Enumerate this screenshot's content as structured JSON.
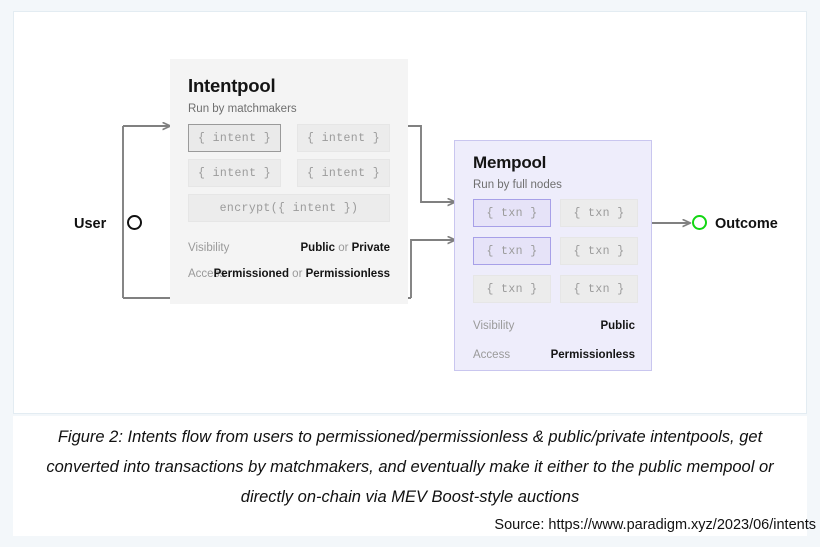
{
  "figure": {
    "caption": "Figure 2: Intents flow from users to permissioned/permissionless & public/private intentpools, get converted into transactions by matchmakers, and eventually make it either to the public mempool or directly on-chain via MEV Boost-style auctions",
    "source": "Source: https://www.paradigm.xyz/2023/06/intents"
  },
  "endpoints": {
    "user_label": "User",
    "outcome_label": "Outcome",
    "user_node_color": "#111111",
    "outcome_node_color": "#12d612"
  },
  "intentpool": {
    "title": "Intentpool",
    "subtitle": "Run by matchmakers",
    "chips": [
      {
        "label": "{ intent }",
        "highlighted": true
      },
      {
        "label": "{ intent }",
        "highlighted": false
      },
      {
        "label": "{ intent }",
        "highlighted": false
      },
      {
        "label": "{ intent }",
        "highlighted": false
      }
    ],
    "encrypt_chip": "encrypt({ intent })",
    "meta": [
      {
        "label": "Visibility",
        "parts": [
          {
            "text": "Public",
            "strong": true
          },
          {
            "text": " or ",
            "strong": false
          },
          {
            "text": "Private",
            "strong": true
          }
        ]
      },
      {
        "label": "Access",
        "parts": [
          {
            "text": "Permissioned",
            "strong": true
          },
          {
            "text": " or ",
            "strong": false
          },
          {
            "text": "Permissionless",
            "strong": true
          }
        ]
      }
    ]
  },
  "mempool": {
    "title": "Mempool",
    "subtitle": "Run by full nodes",
    "chips": [
      {
        "label": "{ txn }",
        "highlighted": true
      },
      {
        "label": "{ txn }",
        "highlighted": false
      },
      {
        "label": "{ txn }",
        "highlighted": true
      },
      {
        "label": "{ txn }",
        "highlighted": false
      },
      {
        "label": "{ txn }",
        "highlighted": false
      },
      {
        "label": "{ txn }",
        "highlighted": false
      }
    ],
    "meta": [
      {
        "label": "Visibility",
        "parts": [
          {
            "text": "Public",
            "strong": true
          }
        ]
      },
      {
        "label": "Access",
        "parts": [
          {
            "text": "Permissionless",
            "strong": true
          }
        ]
      }
    ]
  },
  "colors": {
    "canvas": "#f3f7fa",
    "panel": "#ffffff",
    "intentpool_bg": "#f4f4f4",
    "mempool_bg": "#eeedfb",
    "mempool_border": "#c9c6ef",
    "wire": "#808080"
  }
}
